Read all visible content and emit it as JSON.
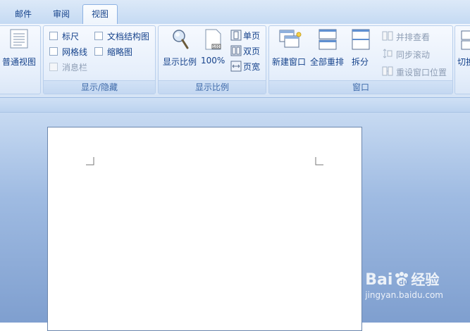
{
  "tabs": [
    {
      "label": "邮件"
    },
    {
      "label": "审阅"
    },
    {
      "label": "视图"
    }
  ],
  "groups": {
    "views": {
      "normal_view": "普通视图"
    },
    "show_hide": {
      "label": "显示/隐藏",
      "ruler": "标尺",
      "gridlines": "网格线",
      "message_bar": "消息栏",
      "doc_map": "文档结构图",
      "thumbnails": "缩略图"
    },
    "zoom": {
      "label": "显示比例",
      "zoom": "显示比例",
      "hundred": "100%",
      "one_page": "单页",
      "two_pages": "双页",
      "page_width": "页宽"
    },
    "window": {
      "label": "窗口",
      "new_window": "新建窗口",
      "arrange_all": "全部重排",
      "split": "拆分",
      "side_by_side": "并排查看",
      "sync_scroll": "同步滚动",
      "reset_position": "重设窗口位置",
      "switch_partial": "切换"
    }
  },
  "watermark": {
    "brand": "Bai",
    "brand2": "经验",
    "url": "jingyan.baidu.com"
  },
  "colors": {
    "ribbon_text": "#15428b",
    "workspace": "#8fb0dc"
  }
}
